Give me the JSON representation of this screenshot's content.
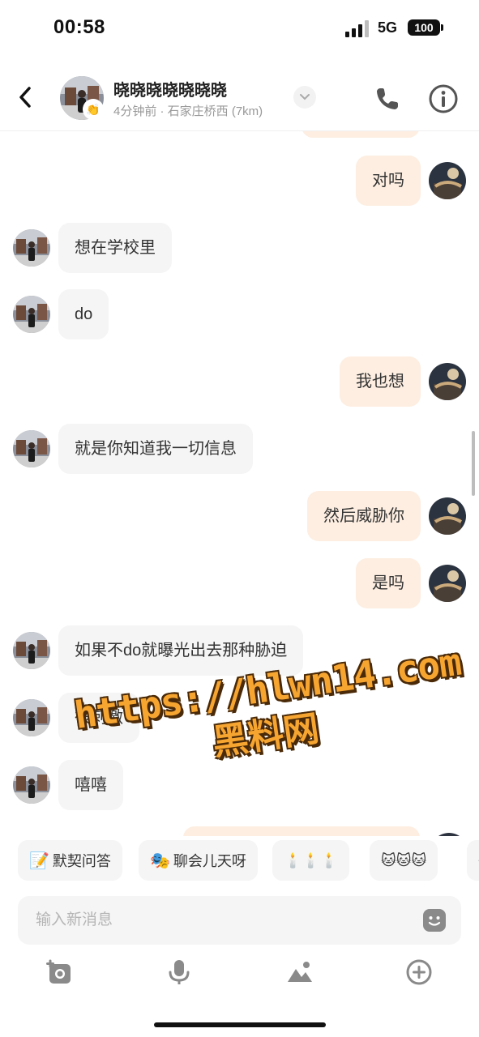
{
  "status": {
    "time": "00:58",
    "network": "5G",
    "battery": "100"
  },
  "header": {
    "name": "晓晓晓晓晓晓晓",
    "subtitle": "4分钟前 · 石家庄桥西 (7km)",
    "badge_icon": "👏"
  },
  "messages": [
    {
      "side": "right",
      "text": "对吗"
    },
    {
      "side": "left",
      "text": "想在学校里"
    },
    {
      "side": "left",
      "text": "do"
    },
    {
      "side": "right",
      "text": "我也想"
    },
    {
      "side": "left",
      "text": "就是你知道我一切信息"
    },
    {
      "side": "right",
      "text": "然后威胁你"
    },
    {
      "side": "right",
      "text": "是吗"
    },
    {
      "side": "left",
      "text": "如果不do就曝光出去那种胁迫"
    },
    {
      "side": "left",
      "text": "很刺激"
    },
    {
      "side": "left",
      "text": "嘻嘻"
    }
  ],
  "watermark": {
    "url": "https://hlwn14.com",
    "text": "黑料网"
  },
  "quick_replies": [
    {
      "icon": "📝",
      "label": "默契问答"
    },
    {
      "icon": "🎭",
      "label": "聊会儿天呀"
    },
    {
      "icon": "",
      "label": "🕯️🕯️🕯️"
    },
    {
      "icon": "",
      "label": "🐱🐱🐱"
    },
    {
      "icon": "",
      "label": "🐱"
    }
  ],
  "input": {
    "placeholder": "输入新消息"
  },
  "colors": {
    "accent": "#fdeee1",
    "bubble_left": "#f5f5f5",
    "watermark": "#f7a531"
  }
}
